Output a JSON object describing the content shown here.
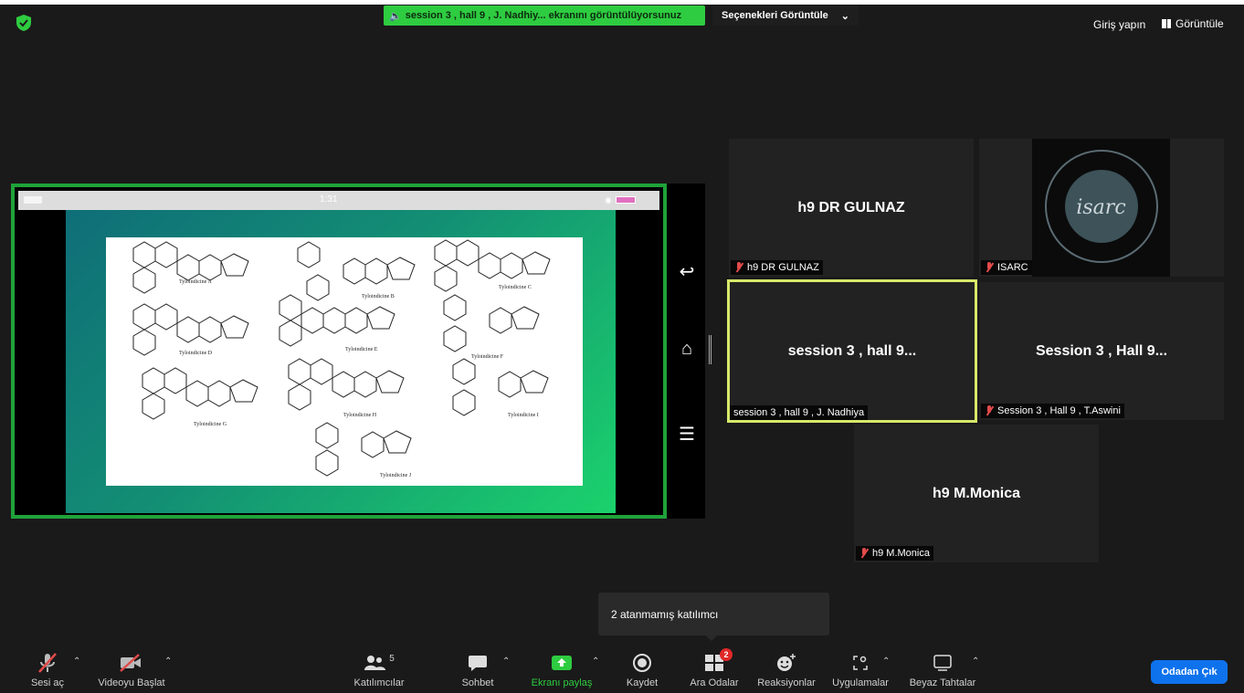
{
  "top": {
    "share_banner": "session 3 , hall 9 , J. Nadhiy... ekranını görüntülüyorsunuz",
    "options_label": "Seçenekleri Görüntüle",
    "signin_label": "Giriş yapın",
    "view_label": "Görüntüle"
  },
  "shared_screen": {
    "phone_time": "1:31",
    "molecules": [
      "Tyloindicine A",
      "Tyloindicine B",
      "Tyloindicine C",
      "Tyloindicine D",
      "Tyloindicine E",
      "Tyloindicine F",
      "Tyloindicine G",
      "Tyloindicine H",
      "Tyloindicine I",
      "Tyloindicine J"
    ]
  },
  "tiles": [
    {
      "center": "h9 DR GULNAZ",
      "label": "h9 DR GULNAZ"
    },
    {
      "center": "",
      "label": "ISARC",
      "logo_text": "isarc"
    },
    {
      "center": "session 3 , hall 9...",
      "label": "session 3 , hall 9 , J. Nadhiya"
    },
    {
      "center": "Session 3 , Hall 9...",
      "label": "Session 3 , Hall 9 , T.Aswini"
    },
    {
      "center": "h9 M.Monica",
      "label": "h9 M.Monica"
    }
  ],
  "tooltip": "2 atanmamış katılımcı",
  "toolbar": {
    "unmute": "Sesi aç",
    "start_video": "Videoyu Başlat",
    "participants": "Katılımcılar",
    "participants_count": "5",
    "chat": "Sohbet",
    "share_screen": "Ekranı paylaş",
    "record": "Kaydet",
    "breakout": "Ara Odalar",
    "breakout_badge": "2",
    "reactions": "Reaksiyonlar",
    "apps": "Uygulamalar",
    "whiteboards": "Beyaz Tahtalar",
    "leave": "Odadan Çık"
  },
  "colors": {
    "share_green": "#2ecc40",
    "frame_green": "#1fa33a",
    "active_speaker": "#d8e86a",
    "leave_blue": "#0e72ed",
    "muted_red": "#e24b4b"
  }
}
